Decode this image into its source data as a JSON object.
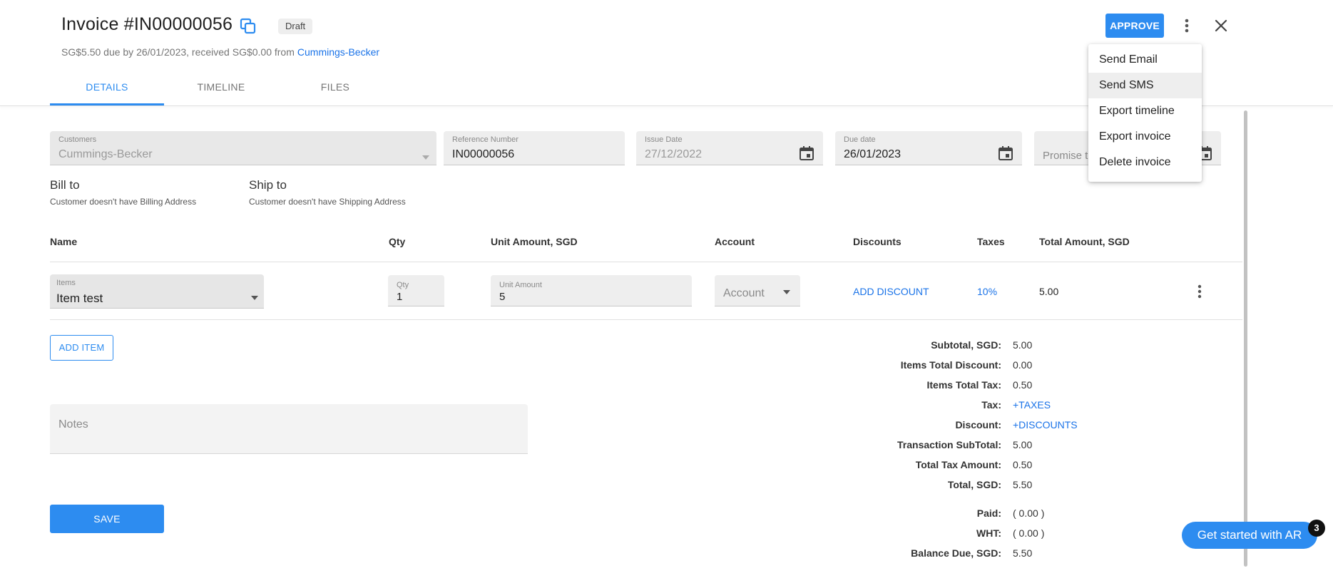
{
  "header": {
    "title": "Invoice #IN00000056",
    "status_badge": "Draft",
    "summary_text": "SG$5.50 due by 26/01/2023, received SG$0.00  from",
    "customer_link": "Cummings-Becker",
    "approve_label": "APPROVE"
  },
  "tabs": [
    {
      "label": "DETAILS",
      "active": true
    },
    {
      "label": "TIMELINE",
      "active": false
    },
    {
      "label": "FILES",
      "active": false
    }
  ],
  "fields": {
    "customers": {
      "label": "Customers",
      "value": "Cummings-Becker"
    },
    "reference": {
      "label": "Reference Number",
      "value": "IN00000056"
    },
    "issue_date": {
      "label": "Issue Date",
      "value": "27/12/2022"
    },
    "due_date": {
      "label": "Due date",
      "value": "26/01/2023"
    },
    "promise_to": {
      "placeholder": "Promise to"
    }
  },
  "addresses": {
    "bill_to": {
      "heading": "Bill to",
      "text": "Customer doesn't have Billing Address"
    },
    "ship_to": {
      "heading": "Ship to",
      "text": "Customer doesn't have Shipping Address"
    }
  },
  "table": {
    "headers": {
      "name": "Name",
      "qty": "Qty",
      "unit_amount": "Unit Amount, SGD",
      "account": "Account",
      "discounts": "Discounts",
      "taxes": "Taxes",
      "total_amount": "Total Amount, SGD"
    },
    "rows": [
      {
        "item_label": "Items",
        "item_value": "Item test",
        "qty_label": "Qty",
        "qty_value": "1",
        "unit_label": "Unit Amount",
        "unit_value": "5",
        "account_placeholder": "Account",
        "discount_link": "ADD DISCOUNT",
        "tax_link": "10%",
        "total": "5.00"
      }
    ]
  },
  "add_item_label": "ADD ITEM",
  "notes_placeholder": "Notes",
  "save_label": "SAVE",
  "totals": [
    {
      "label": "Subtotal, SGD:",
      "value": "5.00",
      "link": false
    },
    {
      "label": "Items Total Discount:",
      "value": "0.00",
      "link": false
    },
    {
      "label": "Items Total Tax:",
      "value": "0.50",
      "link": false
    },
    {
      "label": "Tax:",
      "value": "+TAXES",
      "link": true
    },
    {
      "label": "Discount:",
      "value": "+DISCOUNTS",
      "link": true
    },
    {
      "label": "Transaction SubTotal:",
      "value": "5.00",
      "link": false
    },
    {
      "label": "Total Tax Amount:",
      "value": "0.50",
      "link": false
    },
    {
      "label": "Total, SGD:",
      "value": "5.50",
      "link": false
    },
    {
      "label": "Paid:",
      "value": "( 0.00 )",
      "link": false
    },
    {
      "label": "WHT:",
      "value": "( 0.00 )",
      "link": false
    },
    {
      "label": "Balance Due, SGD:",
      "value": "5.50",
      "link": false
    }
  ],
  "menu": {
    "items": [
      "Send Email",
      "Send SMS",
      "Export timeline",
      "Export invoice",
      "Delete invoice"
    ],
    "hovered": "Send SMS"
  },
  "cta": {
    "label": "Get started with AR",
    "badge": "3"
  },
  "colors": {
    "accent": "#2d8cf0",
    "link": "#1a73e8"
  }
}
